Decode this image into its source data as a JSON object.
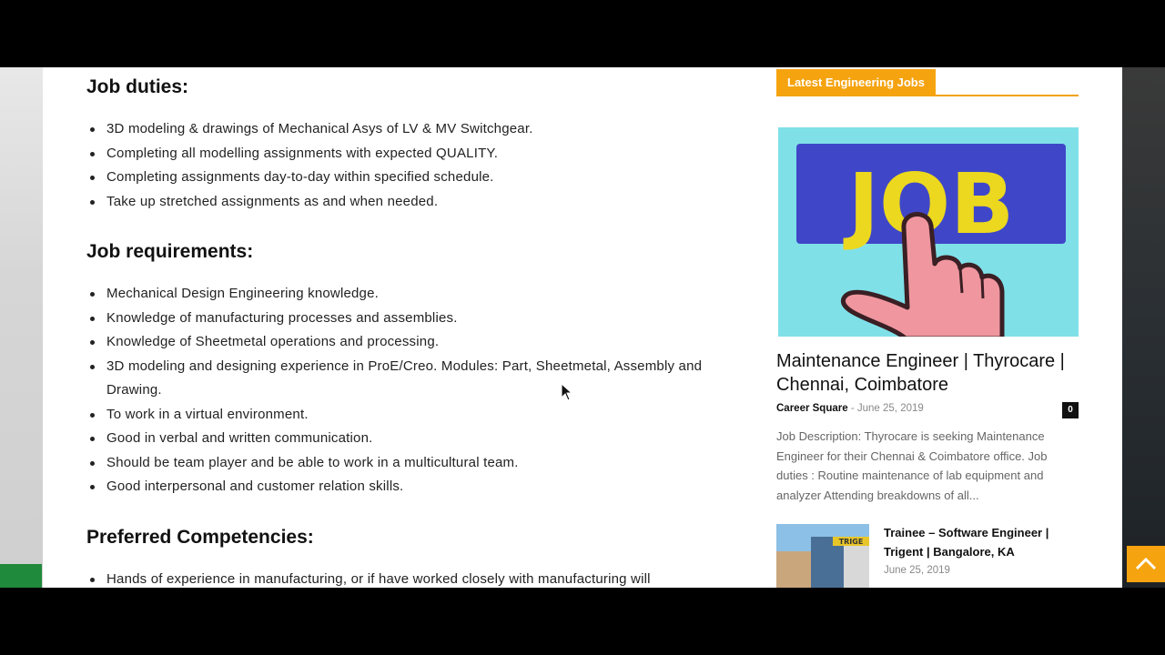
{
  "job_duties": {
    "heading": "Job duties:",
    "items": [
      "3D modeling & drawings of Mechanical Asys of LV & MV Switchgear.",
      "Completing all modelling assignments with expected QUALITY.",
      "Completing assignments day-to-day within specified schedule.",
      "Take up stretched assignments as and when needed."
    ]
  },
  "job_requirements": {
    "heading": "Job requirements:",
    "items": [
      "Mechanical Design Engineering knowledge.",
      "Knowledge of manufacturing processes and assemblies.",
      "Knowledge of Sheetmetal operations and processing.",
      "3D modeling and designing experience in ProE/Creo. Modules: Part, Sheetmetal, Assembly and Drawing.",
      "To work in a virtual environment.",
      "Good in verbal and written communication.",
      "Should be team player and be able to work in a multicultural team.",
      "Good interpersonal and customer relation skills."
    ]
  },
  "preferred_competencies": {
    "heading": "Preferred Competencies:",
    "items": [
      "Hands of experience in manufacturing, or if have worked closely with manufacturing will"
    ]
  },
  "sidebar": {
    "title": "Latest Engineering Jobs",
    "featured": {
      "image_text": "JOB",
      "title": "Maintenance Engineer | Thyrocare | Chennai, Coimbatore",
      "author": "Career Square",
      "separator": "-",
      "date": "June 25, 2019",
      "comments": "0",
      "excerpt": "Job Description: Thyrocare is seeking Maintenance Engineer for their Chennai & Coimbatore office. Job duties : Routine maintenance of lab equipment and analyzer Attending breakdowns of all..."
    },
    "second": {
      "image_text": "TRIGE",
      "title": "Trainee – Software Engineer | Trigent | Bangalore, KA",
      "date": "June 25, 2019"
    }
  },
  "colors": {
    "accent": "#f5a30f",
    "job_blue": "#3f47c8",
    "job_yellow": "#ecd81e",
    "hand_pink": "#f0969f",
    "cyan_bg": "#7fe0e8"
  },
  "icons": {
    "scroll_top": "chevron-up-icon",
    "cursor": "mouse-pointer-icon"
  }
}
